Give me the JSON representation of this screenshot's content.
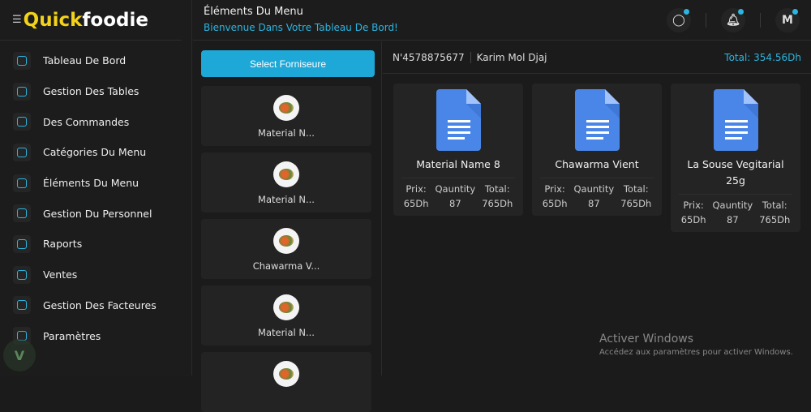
{
  "logo": {
    "part1": "Quick",
    "part2": "foodie"
  },
  "sidebar": {
    "items": [
      {
        "label": "Tableau De Bord"
      },
      {
        "label": "Gestion Des Tables"
      },
      {
        "label": "Des Commandes"
      },
      {
        "label": "Catégories Du Menu"
      },
      {
        "label": "Éléments Du Menu"
      },
      {
        "label": "Gestion Du Personnel"
      },
      {
        "label": "Raports"
      },
      {
        "label": "Ventes"
      },
      {
        "label": "Gestion Des Facteures"
      },
      {
        "label": "Paramètres"
      }
    ]
  },
  "header": {
    "title": "Éléments Du Menu",
    "subtitle": "Bienvenue Dans Votre Tableau De Bord!",
    "avatar": "M"
  },
  "middle": {
    "select_button": "Select Forniseure",
    "materials": [
      {
        "label": "Material N..."
      },
      {
        "label": "Material N..."
      },
      {
        "label": "Chawarma V..."
      },
      {
        "label": "Material N..."
      },
      {
        "label": ""
      }
    ]
  },
  "order": {
    "number": "N'4578875677",
    "client": "Karim Mol Djaj",
    "total": "Total: 354.56Dh"
  },
  "cards": [
    {
      "name": "Material Name 8",
      "prix_label": "Prix:",
      "qty_label": "Qauntity",
      "total_label": "Total:",
      "prix": "65Dh",
      "qty": "87",
      "total": "765Dh"
    },
    {
      "name": "Chawarma Vient",
      "prix_label": "Prix:",
      "qty_label": "Qauntity",
      "total_label": "Total:",
      "prix": "65Dh",
      "qty": "87",
      "total": "765Dh"
    },
    {
      "name": "La Souse Vegitarial 25g",
      "prix_label": "Prix:",
      "qty_label": "Qauntity",
      "total_label": "Total:",
      "prix": "65Dh",
      "qty": "87",
      "total": "765Dh"
    }
  ],
  "watermark": {
    "title": "Activer Windows",
    "sub": "Accédez aux paramètres pour activer Windows."
  },
  "colors": {
    "accent": "#2bb5e0",
    "logo_yellow": "#f3d21b",
    "doc_blue": "#4a86e8"
  }
}
